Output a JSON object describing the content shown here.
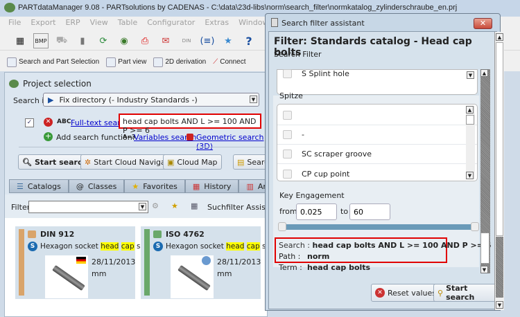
{
  "window": {
    "title": "PARTdataManager 9.08 - PARTsolutions by CADENAS - C:\\data\\23d-libs\\norm\\search_filter\\normkatalog_zylinderschraube_en.prj"
  },
  "menu": [
    "File",
    "Export",
    "ERP",
    "View",
    "Table",
    "Configurator",
    "Extras",
    "Window",
    "?"
  ],
  "toolbar2": {
    "search_part": "Search and Part Selection",
    "part_view": "Part view",
    "derivation": "2D derivation",
    "connect": "Connect"
  },
  "project": {
    "title": "Project selection",
    "search_in_label": "Search in",
    "search_in_value": "Fix directory (- Industry Standards -)",
    "abc": "ABC",
    "fulltext_link": "Full-text search",
    "fulltext_value": "head cap bolts AND L >= 100 AND P >= 6",
    "add_function": "Add search function:",
    "var_icon": "A=3",
    "variables_link": "Variables search",
    "geometric_link": "Geometric search (3D)",
    "start_search": "Start search",
    "cloud_nav": "Start Cloud Navigator",
    "cloud_map": "Cloud Map",
    "search_btn": "Search",
    "tabs": [
      "Catalogs",
      "Classes",
      "Favorites",
      "History",
      "Ana"
    ],
    "filter_label": "Filter:",
    "suchfilter": "Suchfilter Assistent g"
  },
  "results": [
    {
      "name": "DIN 912",
      "desc_pre": "Hexagon socket ",
      "hl1": "head",
      "hl2": "cap",
      "desc_post": "screw",
      "date": "28/11/2013",
      "unit": "mm",
      "color": "#d9a46a",
      "badge": "DIN"
    },
    {
      "name": "ISO 4762",
      "desc_pre": "Hexagon socket ",
      "hl1": "head",
      "hl2": "cap",
      "desc_post": "screw",
      "date": "28/11/2013",
      "unit": "mm",
      "color": "#6aa86a",
      "badge": "ISO"
    }
  ],
  "dialog": {
    "title": "Search filter assistant",
    "heading": "Filter: Standards catalog - Head cap bolts",
    "subheading": "Search Filter",
    "splint": "S Splint hole",
    "spitze_label": "Spitze",
    "spitze_items": [
      "",
      "-",
      "SC scraper groove",
      "CP cup point"
    ],
    "key_label": "Key Engagement",
    "from_label": "from",
    "from_value": "0.025",
    "to_label": "to",
    "to_value": "60",
    "slider_range": [
      0.025,
      60
    ],
    "search_label": "Search :",
    "search_value": "head cap bolts AND L >= 100 AND P >= 6",
    "path_label": "Path :",
    "path_value": "norm",
    "term_label": "Term :",
    "term_value": "head cap bolts",
    "reset": "Reset values",
    "start": "Start search"
  },
  "colors": {
    "highlight_box": "#e00000",
    "slider": "#6a9ab8"
  }
}
